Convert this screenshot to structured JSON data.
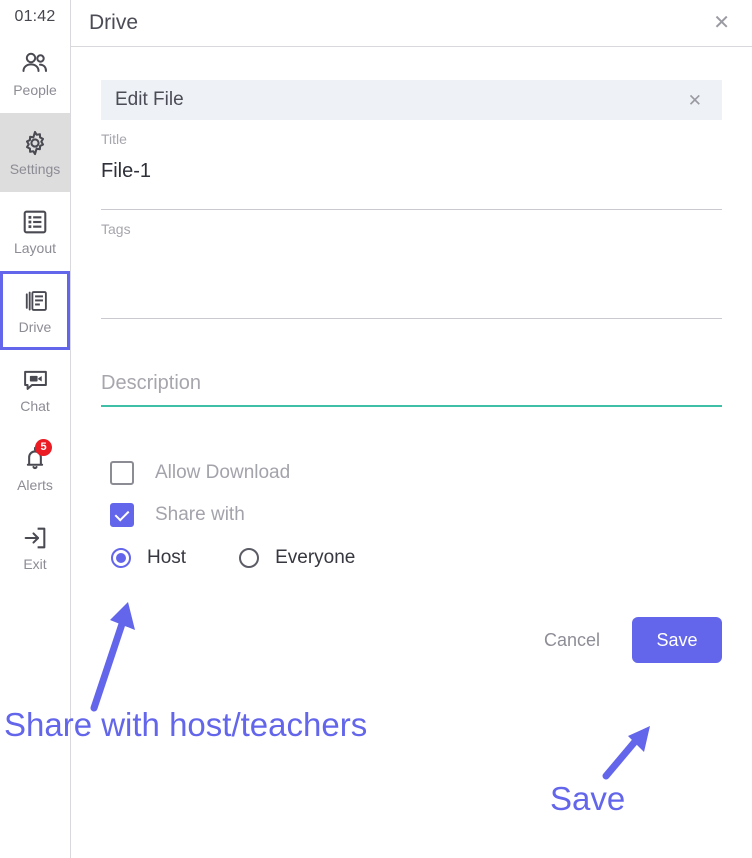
{
  "sidebar": {
    "clock": "01:42",
    "items": [
      {
        "label": "People",
        "icon": "people-icon",
        "state": "normal",
        "badge": null
      },
      {
        "label": "Settings",
        "icon": "gear-icon",
        "state": "filled",
        "badge": null
      },
      {
        "label": "Layout",
        "icon": "layout-icon",
        "state": "normal",
        "badge": null
      },
      {
        "label": "Drive",
        "icon": "drive-icon",
        "state": "outlined",
        "badge": null
      },
      {
        "label": "Chat",
        "icon": "chat-video-icon",
        "state": "normal",
        "badge": null
      },
      {
        "label": "Alerts",
        "icon": "bell-icon",
        "state": "normal",
        "badge": "5"
      },
      {
        "label": "Exit",
        "icon": "exit-icon",
        "state": "normal",
        "badge": null
      }
    ]
  },
  "header": {
    "title": "Drive",
    "close_label": "✕"
  },
  "card": {
    "title": "Edit File",
    "close_label": "✕"
  },
  "form": {
    "title_label": "Title",
    "title_value": "File-1",
    "tags_label": "Tags",
    "tags_value": "",
    "description_placeholder": "Description",
    "description_value": ""
  },
  "options": {
    "allow_download": {
      "label": "Allow Download",
      "checked": false
    },
    "share_with": {
      "label": "Share with",
      "checked": true
    },
    "share_scope": {
      "selected": "Host",
      "choices": [
        {
          "label": "Host",
          "selected": true
        },
        {
          "label": "Everyone",
          "selected": false
        }
      ]
    }
  },
  "actions": {
    "cancel_label": "Cancel",
    "save_label": "Save"
  },
  "annotations": {
    "share_note": "Share with host/teachers",
    "save_note": "Save"
  },
  "colors": {
    "accent_purple": "#6366ea",
    "badge_red": "#ec1c24",
    "description_underline": "#3fbfa5",
    "card_header_bg": "#eef1f6",
    "sidebar_active_bg": "#dddddd"
  }
}
